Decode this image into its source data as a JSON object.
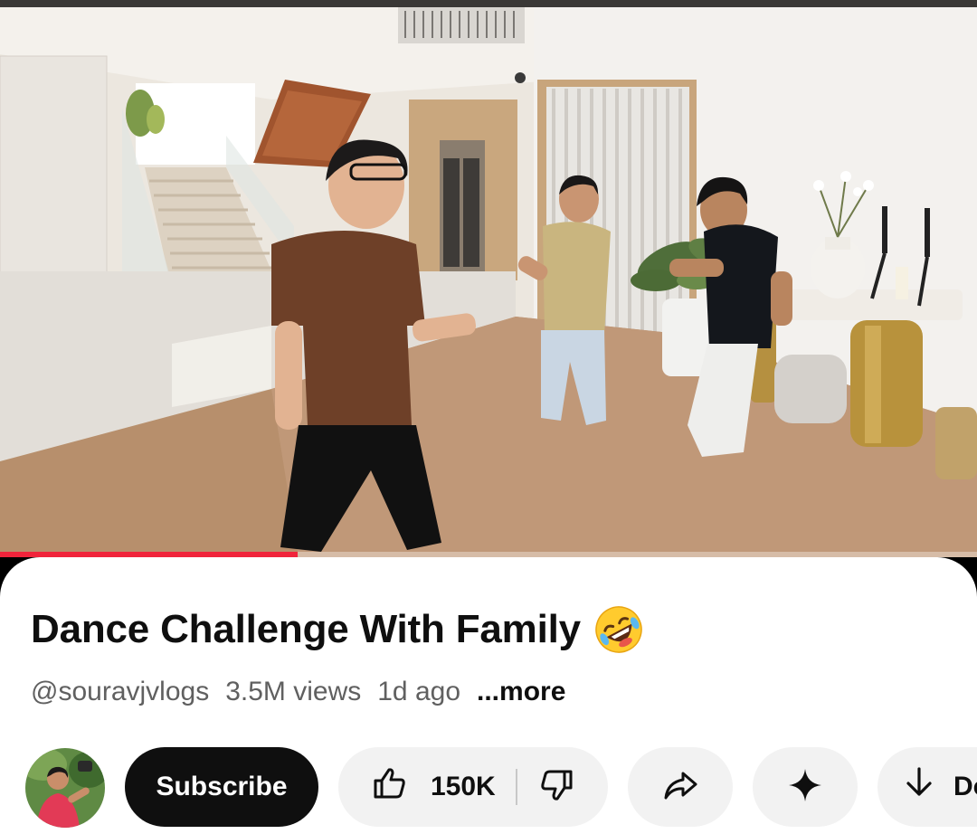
{
  "video": {
    "progress": 0.305,
    "colors": {
      "progress": "#f0243b",
      "wall": "#ece7df",
      "floor": "#b78f6c",
      "marble": "#e2ded8"
    }
  },
  "details": {
    "title": "Dance Challenge With Family",
    "title_emoji": "rolling-on-the-floor-laughing-emoji",
    "channel_handle": "@souravjvlogs",
    "views": "3.5M views",
    "age": "1d ago",
    "more_label": "...more"
  },
  "actions": {
    "subscribe_label": "Subscribe",
    "like_count": "150K",
    "download_label": "Do",
    "icons": {
      "like": "thumbs-up-icon",
      "dislike": "thumbs-down-icon",
      "share": "share-arrow-icon",
      "remix": "sparkle-icon",
      "download": "download-arrow-icon"
    },
    "colors": {
      "subscribe_bg": "#0f0f0f",
      "pill_bg": "#f2f2f2"
    }
  }
}
